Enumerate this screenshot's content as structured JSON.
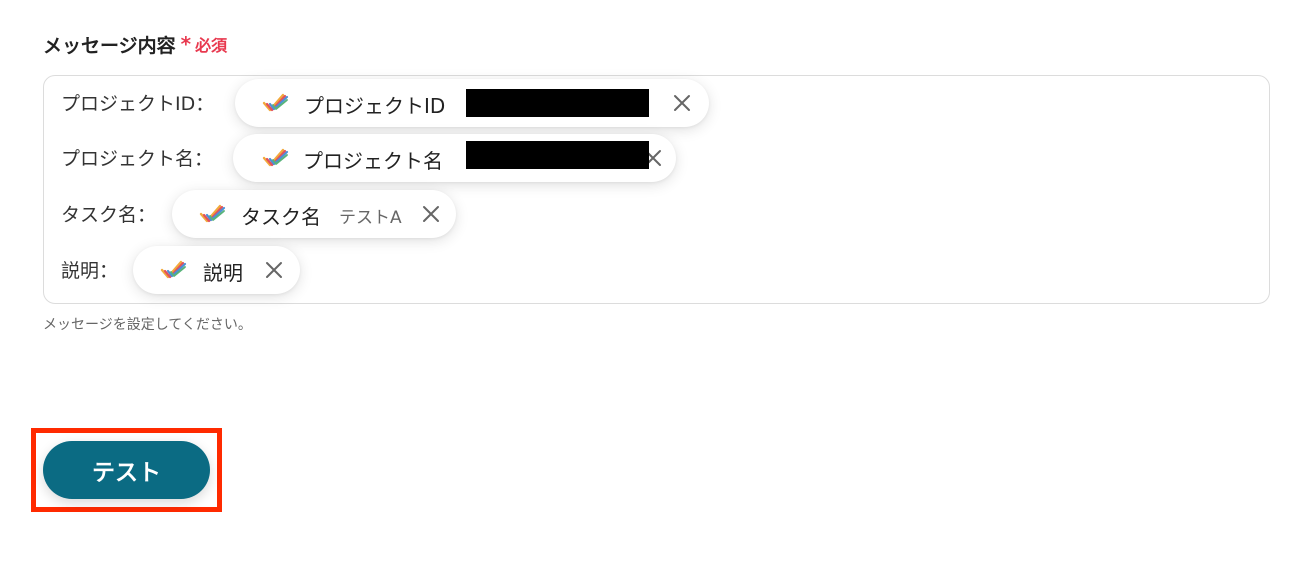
{
  "field": {
    "label": "メッセージ内容",
    "required_mark": "*",
    "required_text": "必須",
    "helper": "メッセージを設定してください。"
  },
  "lines": [
    {
      "label": "プロジェクトID：",
      "chip": {
        "icon": "check-app-icon",
        "name": "プロジェクトID",
        "value": "",
        "redacted": true
      }
    },
    {
      "label": "プロジェクト名：",
      "chip": {
        "icon": "check-app-icon",
        "name": "プロジェクト名",
        "value": "",
        "redacted": true
      }
    },
    {
      "label": "タスク名：",
      "chip": {
        "icon": "check-app-icon",
        "name": "タスク名",
        "value": "テストA",
        "redacted": false
      }
    },
    {
      "label": "説明：",
      "chip": {
        "icon": "check-app-icon",
        "name": "説明",
        "value": "",
        "redacted": false
      }
    }
  ],
  "button": {
    "label": "テスト"
  },
  "colors": {
    "accent": "#0b6b83",
    "required": "#e8394f",
    "highlight": "#ff2a00"
  }
}
